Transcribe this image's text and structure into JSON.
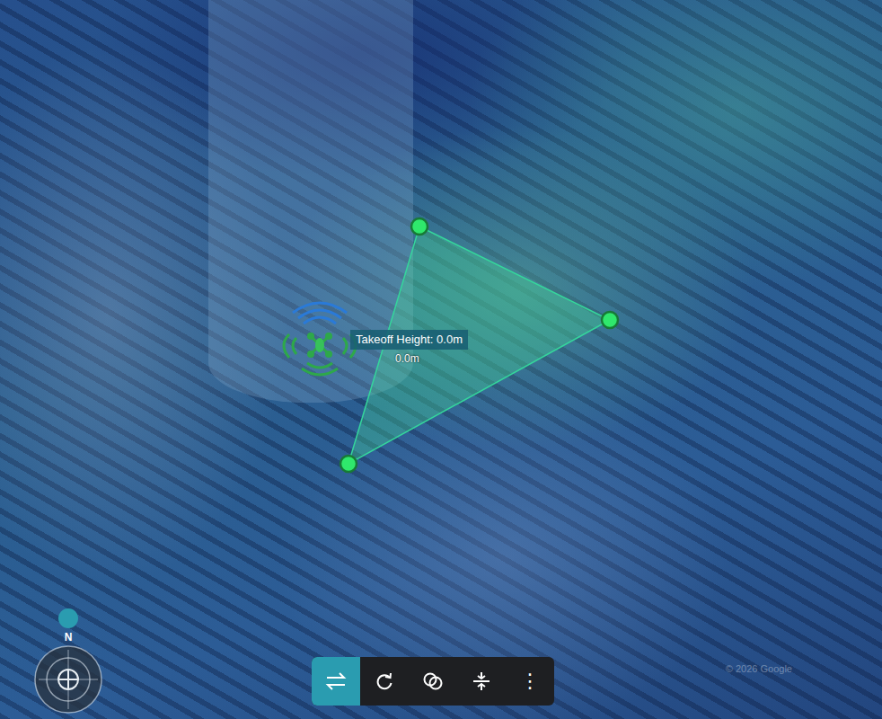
{
  "map": {
    "attribution": "© 2026 Google"
  },
  "takeoff": {
    "label": "Takeoff Height: 0.0m",
    "altitude": "0.0m"
  },
  "compass": {
    "north": "N"
  },
  "toolbar": {
    "buttons": [
      {
        "label": "",
        "selected": true
      },
      {
        "label": "",
        "selected": false
      },
      {
        "label": "",
        "selected": false
      },
      {
        "label": "",
        "selected": false
      },
      {
        "label": "⋮",
        "selected": false
      }
    ]
  }
}
